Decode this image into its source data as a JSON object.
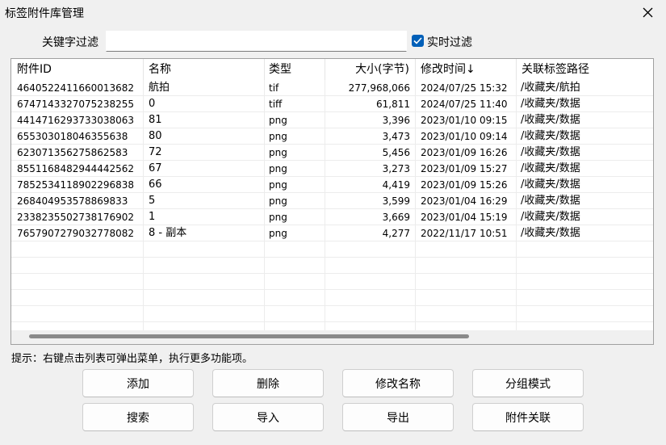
{
  "window": {
    "title": "标签附件库管理"
  },
  "filter": {
    "label": "关键字过滤",
    "value": "",
    "realtime_label": "实时过滤",
    "realtime_checked": true
  },
  "table": {
    "columns": [
      "附件ID",
      "名称",
      "类型",
      "大小(字节)",
      "修改时间↓",
      "关联标签路径"
    ],
    "rows": [
      [
        "4640522411660013682",
        "航拍",
        "tif",
        "277,968,066",
        "2024/07/25 15:32",
        "/收藏夹/航拍"
      ],
      [
        "6747143327075238255",
        "0",
        "tiff",
        "61,811",
        "2024/07/25 11:40",
        "/收藏夹/数据"
      ],
      [
        "4414716293733038063",
        "81",
        "png",
        "3,396",
        "2023/01/10 09:15",
        "/收藏夹/数据"
      ],
      [
        "655303018046355638",
        "80",
        "png",
        "3,473",
        "2023/01/10 09:14",
        "/收藏夹/数据"
      ],
      [
        "623071356275862583",
        "72",
        "png",
        "5,456",
        "2023/01/09 16:26",
        "/收藏夹/数据"
      ],
      [
        "8551168482944442562",
        "67",
        "png",
        "3,273",
        "2023/01/09 15:27",
        "/收藏夹/数据"
      ],
      [
        "7852534118902296838",
        "66",
        "png",
        "4,419",
        "2023/01/09 15:26",
        "/收藏夹/数据"
      ],
      [
        "268404953578869833",
        "5",
        "png",
        "3,599",
        "2023/01/04 16:29",
        "/收藏夹/数据"
      ],
      [
        "2338235502738176902",
        "1",
        "png",
        "3,669",
        "2023/01/04 15:19",
        "/收藏夹/数据"
      ],
      [
        "7657907279032778082",
        "8 - 副本",
        "png",
        "4,277",
        "2022/11/17 10:51",
        "/收藏夹/数据"
      ]
    ]
  },
  "hint": "提示：右键点击列表可弹出菜单，执行更多功能项。",
  "buttons": {
    "add": "添加",
    "delete": "删除",
    "rename": "修改名称",
    "group_mode": "分组模式",
    "search": "搜索",
    "import": "导入",
    "export": "导出",
    "attach_link": "附件关联"
  },
  "colors": {
    "accent": "#005fb8",
    "background": "#f0f0f0"
  }
}
